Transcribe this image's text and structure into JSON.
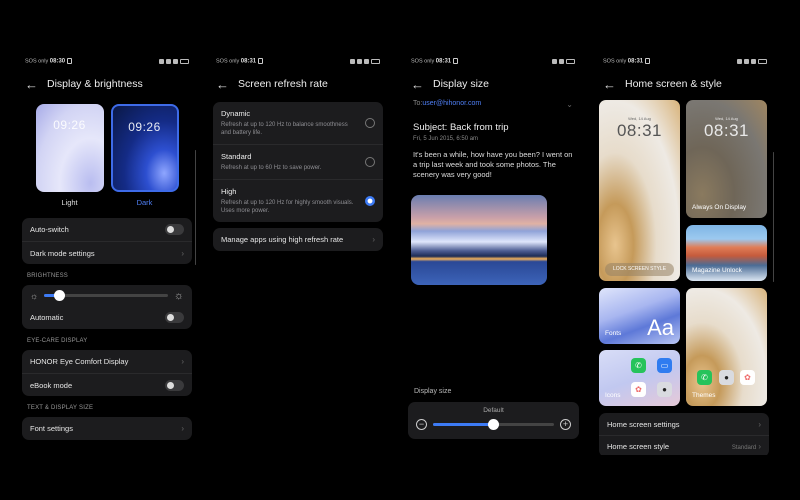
{
  "status_bars": [
    {
      "carrier": "SOS only",
      "time": "08:30"
    },
    {
      "carrier": "SOS only",
      "time": "08:31"
    },
    {
      "carrier": "SOS only",
      "time": "08:31"
    },
    {
      "carrier": "SOS only",
      "time": "08:31"
    }
  ],
  "display_brightness": {
    "title": "Display & brightness",
    "themes": [
      {
        "clock": "09:26",
        "label": "Light",
        "selected": false
      },
      {
        "clock": "09:26",
        "label": "Dark",
        "selected": true
      }
    ],
    "auto_switch": {
      "label": "Auto-switch",
      "on": false
    },
    "dark_mode_settings": "Dark mode settings",
    "brightness_header": "BRIGHTNESS",
    "brightness_level": 0.12,
    "automatic": {
      "label": "Automatic",
      "on": false
    },
    "eye_care_header": "EYE-CARE DISPLAY",
    "eye_comfort": "HONOR Eye Comfort Display",
    "ebook": {
      "label": "eBook mode",
      "on": false
    },
    "text_display_header": "TEXT & DISPLAY SIZE",
    "font_settings": "Font settings"
  },
  "refresh_rate": {
    "title": "Screen refresh rate",
    "options": [
      {
        "title": "Dynamic",
        "desc": "Refresh at up to 120 Hz to balance smoothness and battery life.",
        "selected": false
      },
      {
        "title": "Standard",
        "desc": "Refresh at up to 60 Hz to save power.",
        "selected": false
      },
      {
        "title": "High",
        "desc": "Refresh at up to 120 Hz for highly smooth visuals. Uses more power.",
        "selected": true
      }
    ],
    "manage_apps": "Manage apps using high refresh rate"
  },
  "display_size": {
    "title": "Display size",
    "to_prefix": "To:",
    "to_address": "user@hihonor.com",
    "subject": "Subject: Back from trip",
    "date": "Fri, 5 Jun 2015, 6:50 am",
    "body": "It's been a while, how have you been? I went on a trip last week and took some photos. The scenery was very good!",
    "size_label": "Display size",
    "size_value": "Default",
    "size_level": 0.5
  },
  "home_screen": {
    "title": "Home screen & style",
    "lock_tile": {
      "date": "Wed, 14 Aug",
      "time": "08:31",
      "button": "LOCK SCREEN STYLE"
    },
    "aod_tile": {
      "date": "Wed, 14 Aug",
      "time": "08:31",
      "label": "Always On Display"
    },
    "magazine_label": "Magazine Unlock",
    "fonts_label": "Fonts",
    "fonts_glyph": "Aa",
    "icons_label": "Icons",
    "themes_label": "Themes",
    "settings": [
      {
        "label": "Home screen settings",
        "value": ""
      },
      {
        "label": "Home screen style",
        "value": "Standard"
      }
    ]
  },
  "colors": {
    "accent": "#3d7bf5",
    "card": "#1c1c1e",
    "background": "#000000"
  }
}
